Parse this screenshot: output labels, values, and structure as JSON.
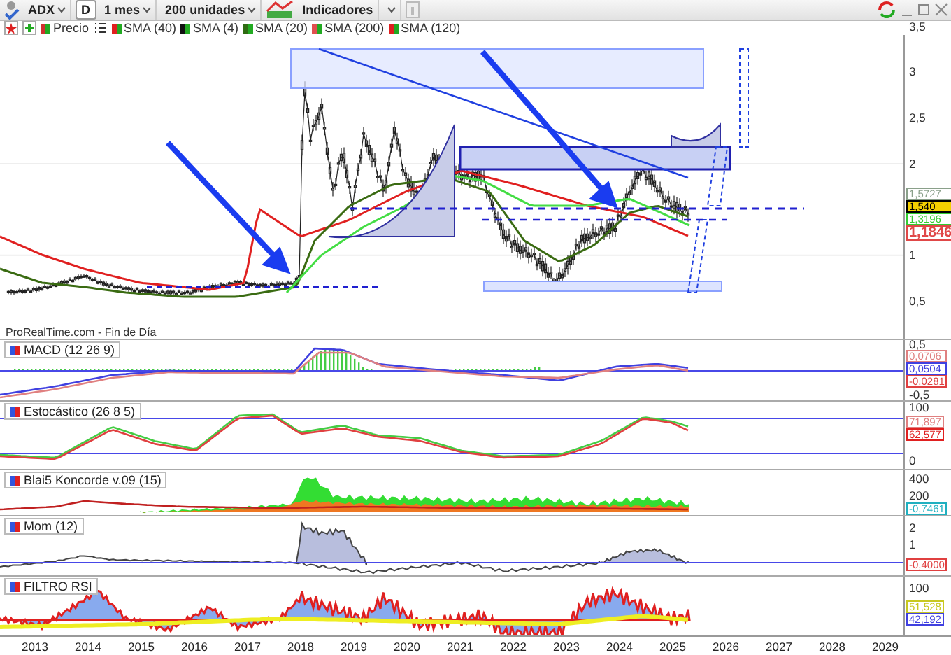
{
  "toolbar": {
    "symbol": "ADX",
    "period_button": "D",
    "interval": "1 mes",
    "units": "200 unidades",
    "indicators": "Indicadores"
  },
  "legend": [
    {
      "label": "Precio",
      "color": "#d03030"
    },
    {
      "label": "SMA (40)",
      "color": "#e02020"
    },
    {
      "label": "SMA (4)",
      "color": "#111111"
    },
    {
      "label": "SMA (20)",
      "color": "#2e6b12"
    },
    {
      "label": "SMA (200)",
      "color": "#e05050"
    },
    {
      "label": "SMA (120)",
      "color": "#e02020"
    }
  ],
  "main_chart": {
    "source_label": "ProRealTime.com - Fin de Día",
    "ticks": [
      "3,5",
      "3",
      "2,5",
      "2",
      "1",
      "0,5"
    ],
    "readings": [
      {
        "text": "1,5727",
        "color": "#8aa08a"
      },
      {
        "text": "1,540",
        "color": "#000000"
      },
      {
        "text": "1,3196",
        "color": "#33cc33"
      },
      {
        "text": "1,1846",
        "color": "#e04848"
      }
    ]
  },
  "panels": [
    {
      "kind": "macd",
      "label": "MACD (12 26 9)",
      "ticks": [
        "0,5",
        "-0,5"
      ],
      "readings": [
        {
          "text": "0,0706",
          "color": "#e08080"
        },
        {
          "text": "0,0504",
          "color": "#4040e0"
        },
        {
          "text": "-0,0281",
          "color": "#e04040"
        }
      ]
    },
    {
      "kind": "stochastic",
      "label": "Estocástico (26 8 5)",
      "ticks": [
        "100",
        "0"
      ],
      "readings": [
        {
          "text": "71,897",
          "color": "#e08080"
        },
        {
          "text": "62,577",
          "color": "#e02020"
        }
      ]
    },
    {
      "kind": "koncorde",
      "label": "Blai5 Koncorde v.09 (15)",
      "ticks": [
        "400",
        "200"
      ],
      "readings": [
        {
          "text": "-0,7461",
          "color": "#20b0c0"
        }
      ]
    },
    {
      "kind": "momentum",
      "label": "Mom (12)",
      "ticks": [
        "2",
        "1"
      ],
      "readings": [
        {
          "text": "-0,4000",
          "color": "#e04040"
        }
      ]
    },
    {
      "kind": "rsi",
      "label": "FILTRO RSI",
      "ticks": [
        "100"
      ],
      "readings": [
        {
          "text": "51,528",
          "color": "#c8c820"
        },
        {
          "text": "42,192",
          "color": "#4040e0"
        }
      ]
    }
  ],
  "x_axis": [
    "2013",
    "2014",
    "2015",
    "2016",
    "2017",
    "2018",
    "2019",
    "2020",
    "2021",
    "2022",
    "2023",
    "2024",
    "2025",
    "2026",
    "2027",
    "2028",
    "2029"
  ]
}
